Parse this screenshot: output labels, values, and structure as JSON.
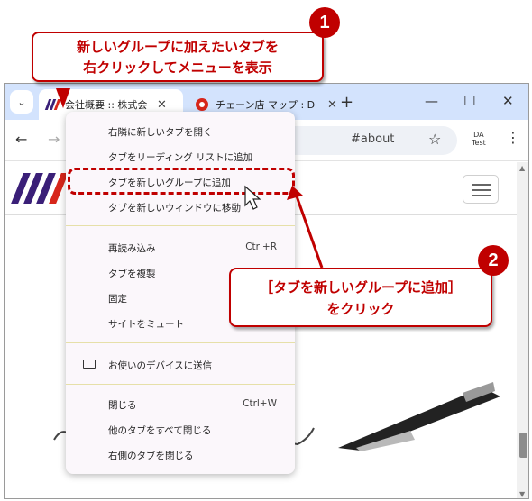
{
  "callout1": {
    "line1": "新しいグループに加えたいタブを",
    "line2": "右クリックしてメニューを表示",
    "badge": "1"
  },
  "callout2": {
    "line1": "［タブを新しいグループに追加］",
    "line2": "をクリック",
    "badge": "2"
  },
  "tabs": [
    {
      "title": "会社概要 :: 株式会"
    },
    {
      "title": "チェーン店 マップ : D"
    }
  ],
  "address": {
    "url_fragment": "#about"
  },
  "profile": {
    "line1": "DA",
    "line2": "Test"
  },
  "context_menu": {
    "items": [
      {
        "label": "右隣に新しいタブを開く",
        "shortcut": ""
      },
      {
        "label": "タブをリーディング リストに追加",
        "shortcut": ""
      },
      {
        "label": "タブを新しいグループに追加",
        "shortcut": ""
      },
      {
        "label": "タブを新しいウィンドウに移動",
        "shortcut": ""
      },
      {
        "label": "再読み込み",
        "shortcut": "Ctrl+R"
      },
      {
        "label": "タブを複製",
        "shortcut": ""
      },
      {
        "label": "固定",
        "shortcut": ""
      },
      {
        "label": "サイトをミュート",
        "shortcut": ""
      },
      {
        "label": "お使いのデバイスに送信",
        "shortcut": ""
      },
      {
        "label": "閉じる",
        "shortcut": "Ctrl+W"
      },
      {
        "label": "他のタブをすべて閉じる",
        "shortcut": ""
      },
      {
        "label": "右側のタブを閉じる",
        "shortcut": ""
      }
    ]
  },
  "icons": {
    "tab_search": "chevron-down-icon",
    "close": "close-icon",
    "new_tab": "plus-icon",
    "minimize": "minimize-icon",
    "maximize": "maximize-icon",
    "window_close": "close-icon",
    "back": "back-arrow-icon",
    "forward": "forward-arrow-icon",
    "bookmark": "star-icon",
    "menu": "kebab-menu-icon",
    "hamburger": "hamburger-icon",
    "device": "laptop-icon"
  },
  "colors": {
    "accent_red": "#c00000",
    "tabstrip": "#d3e3fd",
    "logo_purple": "#3a1f78",
    "logo_red": "#d7261b"
  }
}
